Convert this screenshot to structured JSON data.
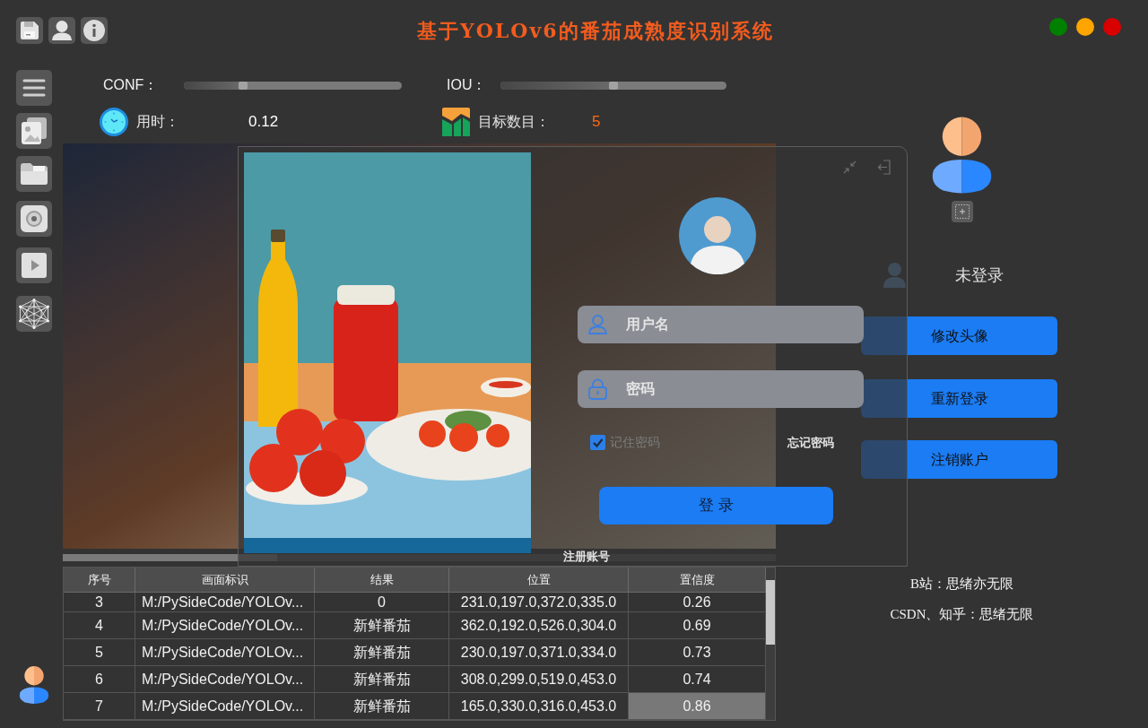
{
  "title": "基于YOLOv6的番茄成熟度识别系统",
  "sliders": [
    {
      "label": "CONF：",
      "level": 0.27
    },
    {
      "label": "IOU：",
      "level": 0.5
    }
  ],
  "elapsed": {
    "label": "用时：",
    "value": "0.12"
  },
  "targets": {
    "label": "目标数目：",
    "value": "5"
  },
  "progress": {
    "level": 0.3
  },
  "table": {
    "columns": [
      "序号",
      "画面标识",
      "结果",
      "位置",
      "置信度"
    ],
    "rows": [
      {
        "cells": [
          "3",
          "M:/PySideCode/YOLOv...",
          "0",
          "231.0,197.0,372.0,335.0",
          "0.26"
        ],
        "selected": false
      },
      {
        "cells": [
          "4",
          "M:/PySideCode/YOLOv...",
          "新鲜番茄",
          "362.0,192.0,526.0,304.0",
          "0.69"
        ],
        "selected": false
      },
      {
        "cells": [
          "5",
          "M:/PySideCode/YOLOv...",
          "新鲜番茄",
          "230.0,197.0,371.0,334.0",
          "0.73"
        ],
        "selected": false
      },
      {
        "cells": [
          "6",
          "M:/PySideCode/YOLOv...",
          "新鲜番茄",
          "308.0,299.0,519.0,453.0",
          "0.74"
        ],
        "selected": false
      },
      {
        "cells": [
          "7",
          "M:/PySideCode/YOLOv...",
          "新鲜番茄",
          "165.0,330.0,316.0,453.0",
          "0.86"
        ],
        "selected": true
      }
    ]
  },
  "user_panel": {
    "status": "未登录",
    "buttons": [
      "修改头像",
      "重新登录",
      "注销账户"
    ],
    "credits": [
      "B站：思绪亦无限",
      "CSDN、知乎：思绪无限"
    ]
  },
  "login_dialog": {
    "username": {
      "placeholder": "用户名"
    },
    "password": {
      "placeholder": "密码"
    },
    "remember": {
      "label": "记住密码",
      "checked": true
    },
    "forgot_link": "忘记密码",
    "login_button": "登 录",
    "register_link": "注册账号"
  }
}
